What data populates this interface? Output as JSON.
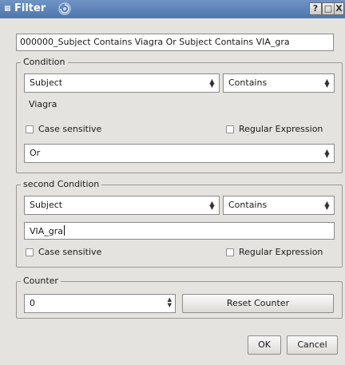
{
  "window": {
    "title": "Filter",
    "icons": {
      "app": "app-icon",
      "swirl": "swirl-icon"
    },
    "buttons": {
      "help": "?",
      "maximize": "□",
      "close": "X"
    }
  },
  "filter_name": "000000_Subject Contains Viagra Or Subject Contains VIA_gra",
  "condition": {
    "label": "Condition",
    "field": "Subject",
    "operator": "Contains",
    "value": "Viagra",
    "case_sensitive_label": "Case sensitive",
    "case_sensitive": false,
    "regex_label": "Regular Expression",
    "regex": false,
    "logic": "Or"
  },
  "second_condition": {
    "label": "second Condition",
    "field": "Subject",
    "operator": "Contains",
    "value": "VIA_gra",
    "case_sensitive_label": "Case sensitive",
    "case_sensitive": false,
    "regex_label": "Regular Expression",
    "regex": false
  },
  "counter": {
    "label": "Counter",
    "value": "0",
    "reset_label": "Reset Counter"
  },
  "footer": {
    "ok_label": "OK",
    "cancel_label": "Cancel"
  },
  "colors": {
    "titlebar": "#5a80b8",
    "window_bg": "#e4e3df"
  }
}
